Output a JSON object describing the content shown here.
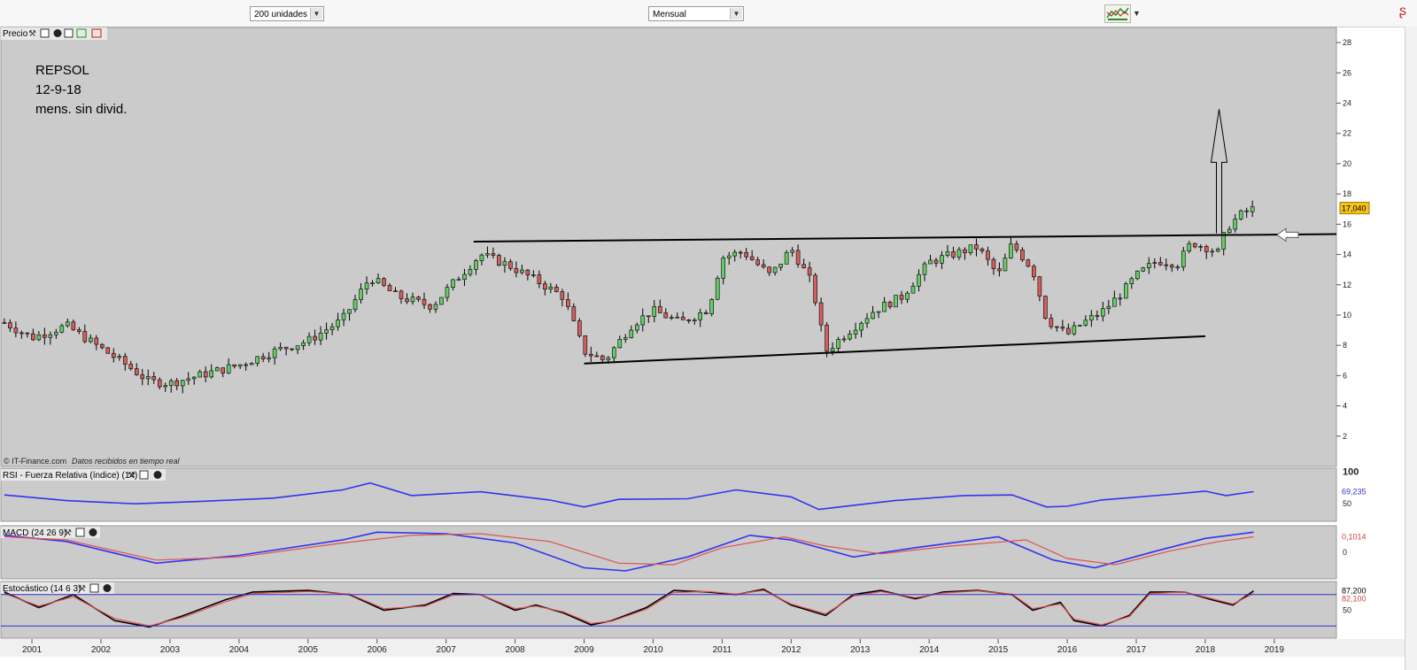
{
  "toolbar": {
    "units_select": "200 unidades",
    "period_select": "Mensual",
    "chart_type_icon": "candlestick-chart-icon"
  },
  "annotation": {
    "line1": "REPSOL",
    "line2": "12-9-18",
    "line3": "mens. sin divid."
  },
  "watermark": "© IT-Finance.com",
  "watermark_note": "Datos recibidos en tiempo real",
  "colors": {
    "background": "#cbcbcb",
    "up_candle": "#66cc66",
    "down_candle": "#d35f5f",
    "rsi_line": "#3333ee",
    "macd_line": "#3333ee",
    "signal_line": "#e25050",
    "price_label": "#f5c518"
  },
  "chart_data": [
    {
      "type": "candlestick",
      "title": "Precio",
      "x_ticks": [
        "2001",
        "2002",
        "2003",
        "2004",
        "2005",
        "2006",
        "2007",
        "2008",
        "2009",
        "2010",
        "2011",
        "2012",
        "2013",
        "2014",
        "2015",
        "2016",
        "2017",
        "2018",
        "2019"
      ],
      "y_ticks": [
        2,
        4,
        6,
        8,
        10,
        12,
        14,
        16,
        18,
        20,
        22,
        24,
        26,
        28
      ],
      "ylim": [
        0,
        29
      ],
      "xlim": [
        2000.55,
        2019.9
      ],
      "last_value": "17,040",
      "series": [
        {
          "name": "close",
          "x": [
            2000.6,
            2001.0,
            2001.5,
            2002.0,
            2002.4,
            2002.7,
            2003.0,
            2003.5,
            2004.0,
            2004.5,
            2005.0,
            2005.5,
            2005.9,
            2006.3,
            2006.8,
            2007.2,
            2007.5,
            2007.9,
            2008.3,
            2008.7,
            2009.0,
            2009.3,
            2009.7,
            2010.0,
            2010.4,
            2010.8,
            2011.0,
            2011.3,
            2011.7,
            2012.0,
            2012.3,
            2012.5,
            2012.8,
            2013.2,
            2013.6,
            2014.0,
            2014.4,
            2014.7,
            2015.0,
            2015.2,
            2015.5,
            2015.7,
            2016.0,
            2016.2,
            2016.5,
            2016.8,
            2017.0,
            2017.3,
            2017.6,
            2017.8,
            2018.0,
            2018.2,
            2018.3,
            2018.5,
            2018.7
          ],
          "y": [
            9.5,
            8.5,
            9.3,
            7.8,
            6.6,
            5.6,
            5.5,
            6.1,
            6.7,
            7.6,
            8.3,
            9.7,
            12.5,
            11.2,
            10.6,
            12.6,
            14.0,
            13.3,
            12.3,
            11.2,
            7.6,
            7.0,
            9.4,
            10.3,
            9.5,
            10.4,
            13.8,
            14.2,
            12.6,
            14.4,
            12.1,
            7.6,
            8.8,
            10.3,
            11.2,
            13.5,
            14.1,
            14.5,
            12.6,
            14.7,
            13.0,
            9.7,
            8.7,
            9.4,
            10.2,
            11.5,
            12.6,
            13.6,
            13.4,
            14.8,
            14.5,
            14.1,
            15.7,
            16.6,
            17.04
          ]
        }
      ],
      "trendlines": [
        {
          "name": "resistance",
          "x": [
            2007.4,
            2019.9
          ],
          "y": [
            14.85,
            15.35
          ]
        },
        {
          "name": "support",
          "x": [
            2009.0,
            2018.0
          ],
          "y": [
            6.8,
            8.6
          ]
        }
      ],
      "target_arrow": {
        "x": 2018.2,
        "from": 15.4,
        "to": 23.6
      }
    },
    {
      "type": "line",
      "title": "RSI - Fuerza Relativa (índice) (14)",
      "y_ticks": [
        50,
        100
      ],
      "ylim": [
        25,
        105
      ],
      "last_value": "69,235",
      "series": [
        {
          "name": "RSI",
          "x": [
            2000.6,
            2001.5,
            2002.5,
            2003.5,
            2004.5,
            2005.5,
            2005.9,
            2006.5,
            2007.5,
            2008.5,
            2009.0,
            2009.5,
            2010.5,
            2011.2,
            2012.0,
            2012.4,
            2013.5,
            2014.5,
            2015.2,
            2015.7,
            2016.0,
            2016.5,
            2017.5,
            2018.0,
            2018.3,
            2018.7
          ],
          "y": [
            64,
            55,
            50,
            54,
            59,
            72,
            83,
            63,
            69,
            56,
            45,
            57,
            58,
            72,
            61,
            41,
            55,
            63,
            64,
            45,
            46,
            56,
            65,
            70,
            63,
            69.2
          ]
        }
      ]
    },
    {
      "type": "line",
      "title": "MACD (24 26 9)",
      "y_ticks": [
        0
      ],
      "ylim": [
        -1.6,
        1.6
      ],
      "last_value": "0,1014",
      "series": [
        {
          "name": "MACD",
          "x": [
            2000.6,
            2001.5,
            2002.8,
            2004.0,
            2005.5,
            2006.0,
            2007.0,
            2008.0,
            2009.0,
            2009.6,
            2010.5,
            2011.4,
            2012.0,
            2012.9,
            2013.8,
            2015.0,
            2015.8,
            2016.4,
            2017.3,
            2018.0,
            2018.7
          ],
          "y": [
            1.1,
            0.7,
            -0.7,
            -0.2,
            0.8,
            1.3,
            1.2,
            0.6,
            -1.0,
            -1.2,
            -0.3,
            1.1,
            0.8,
            -0.3,
            0.3,
            1.0,
            -0.5,
            -1.0,
            0.1,
            0.9,
            1.3
          ]
        },
        {
          "name": "Signal",
          "x": [
            2000.6,
            2001.5,
            2002.8,
            2004.0,
            2005.5,
            2006.5,
            2007.5,
            2008.5,
            2009.5,
            2010.3,
            2011.0,
            2011.9,
            2012.5,
            2013.3,
            2014.3,
            2015.4,
            2016.0,
            2016.7,
            2017.5,
            2018.2,
            2018.7
          ],
          "y": [
            1.0,
            0.8,
            -0.5,
            -0.3,
            0.6,
            1.1,
            1.2,
            0.7,
            -0.7,
            -0.8,
            0.3,
            1.0,
            0.4,
            -0.1,
            0.4,
            0.8,
            -0.4,
            -0.8,
            0.1,
            0.7,
            1.0
          ]
        }
      ]
    },
    {
      "type": "line",
      "title": "Estocástico (14 6 3)",
      "y_ticks": [
        50
      ],
      "ylim": [
        0,
        100
      ],
      "last_values": [
        "87,200",
        "82,100"
      ],
      "series": [
        {
          "name": "%K",
          "x": [
            2000.6,
            2001.1,
            2001.6,
            2002.2,
            2002.7,
            2003.2,
            2003.8,
            2004.2,
            2005.0,
            2005.6,
            2006.1,
            2006.7,
            2007.1,
            2007.5,
            2008.0,
            2008.3,
            2008.7,
            2009.1,
            2009.4,
            2009.9,
            2010.3,
            2010.8,
            2011.2,
            2011.6,
            2012.0,
            2012.5,
            2012.9,
            2013.3,
            2013.8,
            2014.2,
            2014.7,
            2015.2,
            2015.5,
            2015.9,
            2016.1,
            2016.5,
            2016.9,
            2017.2,
            2017.7,
            2018.1,
            2018.4,
            2018.7
          ],
          "y": [
            85,
            55,
            80,
            30,
            18,
            40,
            70,
            85,
            88,
            80,
            50,
            60,
            82,
            80,
            50,
            60,
            45,
            22,
            30,
            55,
            88,
            85,
            80,
            90,
            60,
            40,
            80,
            88,
            72,
            85,
            88,
            80,
            50,
            65,
            30,
            20,
            40,
            85,
            85,
            70,
            60,
            87
          ]
        },
        {
          "name": "%D",
          "x": [
            2000.6,
            2001.1,
            2001.6,
            2002.2,
            2002.7,
            2003.2,
            2003.8,
            2004.2,
            2005.0,
            2005.6,
            2006.1,
            2006.7,
            2007.1,
            2007.5,
            2008.0,
            2008.3,
            2008.7,
            2009.1,
            2009.4,
            2009.9,
            2010.3,
            2010.8,
            2011.2,
            2011.6,
            2012.0,
            2012.5,
            2012.9,
            2013.3,
            2013.8,
            2014.2,
            2014.7,
            2015.2,
            2015.5,
            2015.9,
            2016.1,
            2016.5,
            2016.9,
            2017.2,
            2017.7,
            2018.1,
            2018.4,
            2018.7
          ],
          "y": [
            82,
            58,
            76,
            34,
            20,
            37,
            66,
            82,
            86,
            81,
            53,
            58,
            79,
            80,
            53,
            58,
            47,
            25,
            29,
            52,
            84,
            86,
            81,
            88,
            62,
            43,
            77,
            86,
            74,
            83,
            87,
            81,
            53,
            62,
            33,
            22,
            38,
            82,
            85,
            72,
            62,
            82
          ]
        }
      ]
    }
  ]
}
